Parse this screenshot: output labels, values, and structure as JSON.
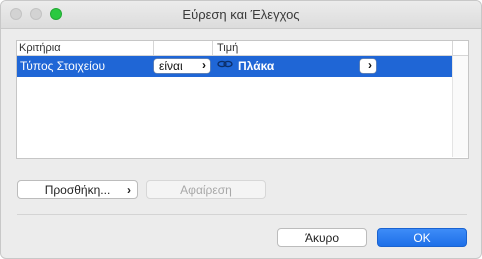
{
  "window": {
    "title": "Εύρεση και Έλεγχος"
  },
  "table": {
    "columns": [
      "Κριτήρια",
      "Τιμή"
    ],
    "rows": [
      {
        "criterion": "Τύπος Στοιχείου",
        "operator": "είναι",
        "value": "Πλάκα",
        "selected": true
      }
    ]
  },
  "buttons": {
    "add": "Προσθήκη...",
    "remove": "Αφαίρεση",
    "cancel": "Άκυρο",
    "ok": "OK"
  },
  "colors": {
    "selection": "#1f66d6",
    "primary_button": "#1d6fe8",
    "green_light": "#2ac940"
  }
}
